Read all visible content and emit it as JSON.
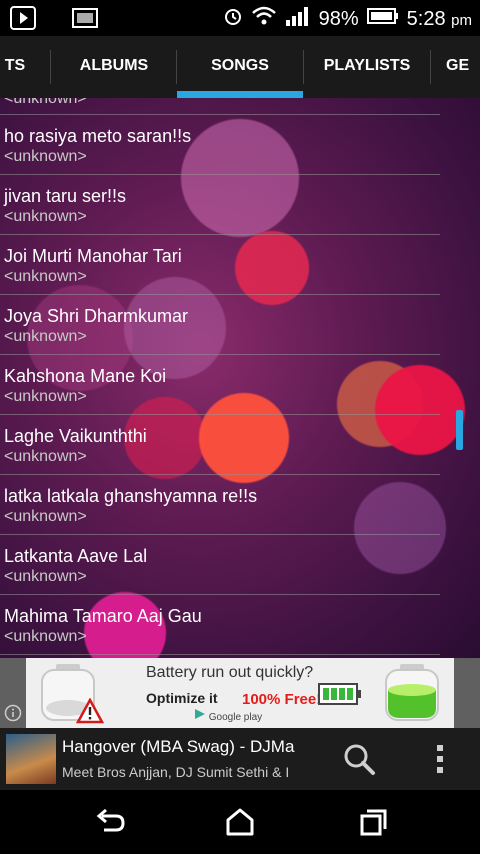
{
  "status_bar": {
    "battery_percent": "98%",
    "time": "5:28",
    "time_suffix": "pm"
  },
  "tabs": [
    {
      "label": "TS"
    },
    {
      "label": "ALBUMS"
    },
    {
      "label": "SONGS"
    },
    {
      "label": "PLAYLISTS"
    },
    {
      "label": "GE"
    }
  ],
  "songs": {
    "partial_top_sub": "<unknown>",
    "items": [
      {
        "title": "ho rasiya meto saran!!s",
        "artist": "<unknown>"
      },
      {
        "title": "jivan taru ser!!s",
        "artist": "<unknown>"
      },
      {
        "title": "Joi Murti Manohar Tari",
        "artist": "<unknown>"
      },
      {
        "title": "Joya Shri Dharmkumar",
        "artist": "<unknown>"
      },
      {
        "title": "Kahshona Mane Koi",
        "artist": "<unknown>"
      },
      {
        "title": "Laghe Vaikunththi",
        "artist": "<unknown>"
      },
      {
        "title": "latka latkala ghanshyamna re!!s",
        "artist": "<unknown>"
      },
      {
        "title": "Latkanta Aave Lal",
        "artist": "<unknown>"
      },
      {
        "title": "Mahima Tamaro Aaj Gau",
        "artist": "<unknown>"
      }
    ]
  },
  "ad": {
    "line1": "Battery run out quickly?",
    "line2": "Optimize it",
    "free": "100% Free!",
    "store": "Google play"
  },
  "now_playing": {
    "title": "Hangover (MBA Swag) - DJMa",
    "artist": "Meet Bros Anjjan, DJ Sumit Sethi & I"
  },
  "colors": {
    "accent": "#2aa7e0",
    "ad_free": "#e61b1b"
  }
}
